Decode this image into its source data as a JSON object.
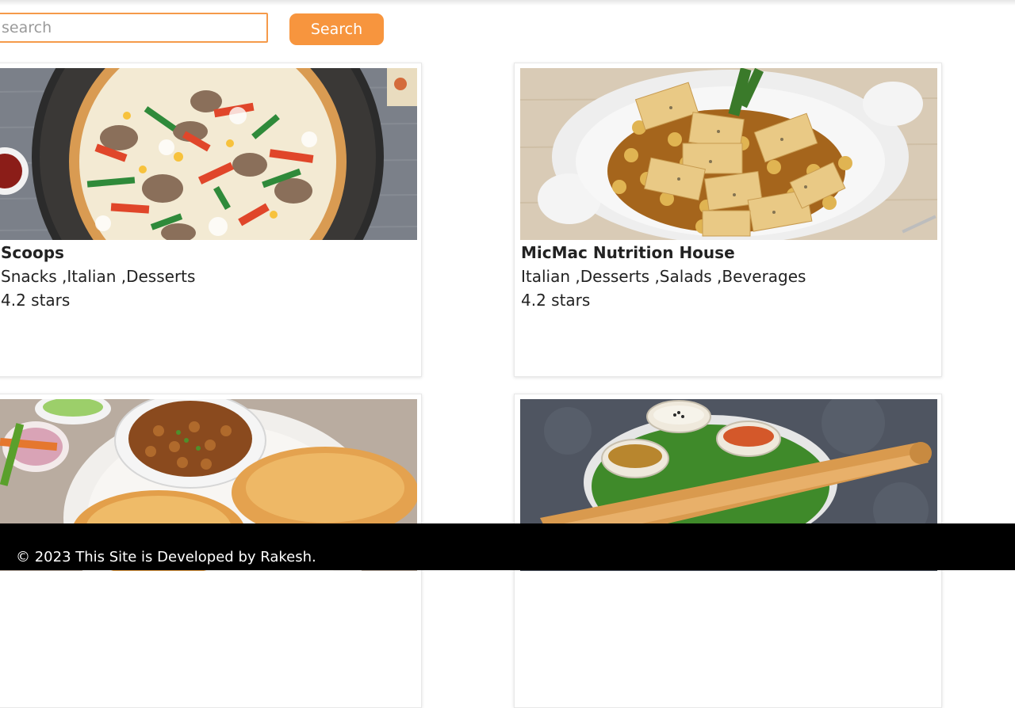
{
  "search": {
    "placeholder": "search",
    "button_label": "Search"
  },
  "restaurants": [
    {
      "name": "Scoops",
      "cuisines": "Snacks ,Italian ,Desserts",
      "rating": "4.2 stars",
      "image_icon": "pizza-photo"
    },
    {
      "name": "MicMac Nutrition House",
      "cuisines": "Italian ,Desserts ,Salads ,Beverages",
      "rating": "4.2 stars",
      "image_icon": "paneer-dish-photo"
    },
    {
      "name": "",
      "cuisines": "",
      "rating": "",
      "image_icon": "chole-bhature-photo"
    },
    {
      "name": "",
      "cuisines": "",
      "rating": "",
      "image_icon": "dosa-photo"
    }
  ],
  "footer": {
    "text": "© 2023 This Site is Developed by Rakesh."
  },
  "colors": {
    "accent": "#f7953e",
    "footer_bg": "#000000"
  }
}
